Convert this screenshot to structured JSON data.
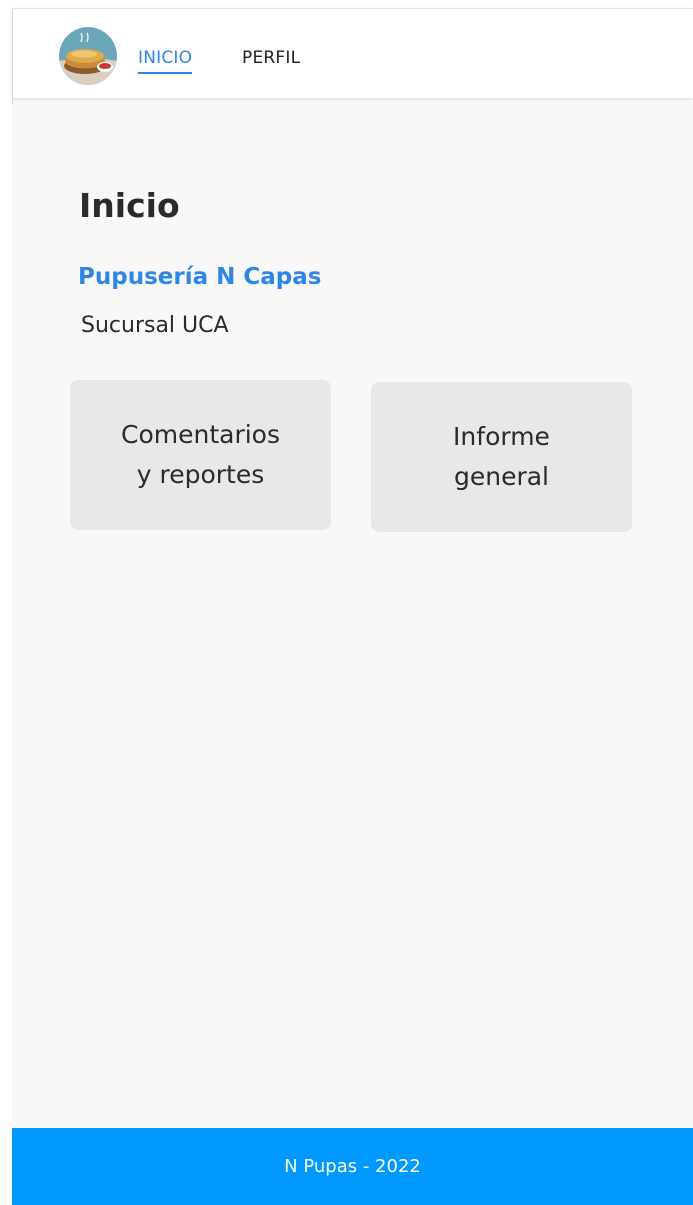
{
  "navbar": {
    "links": [
      {
        "label": "INICIO",
        "active": true
      },
      {
        "label": "PERFIL",
        "active": false
      }
    ]
  },
  "main": {
    "title": "Inicio",
    "business_name": "Pupusería N Capas",
    "branch_name": "Sucursal UCA",
    "cards": [
      {
        "label": "Comentarios\ny reportes"
      },
      {
        "label": "Informe\ngeneral"
      }
    ]
  },
  "footer": {
    "text": "N Pupas - 2022"
  },
  "colors": {
    "accent": "#2f86e8",
    "footer": "#0099ff",
    "card": "#e8e8e8",
    "background": "#f8f8f8"
  },
  "icons": {
    "logo": "pupusa-plate-logo"
  }
}
